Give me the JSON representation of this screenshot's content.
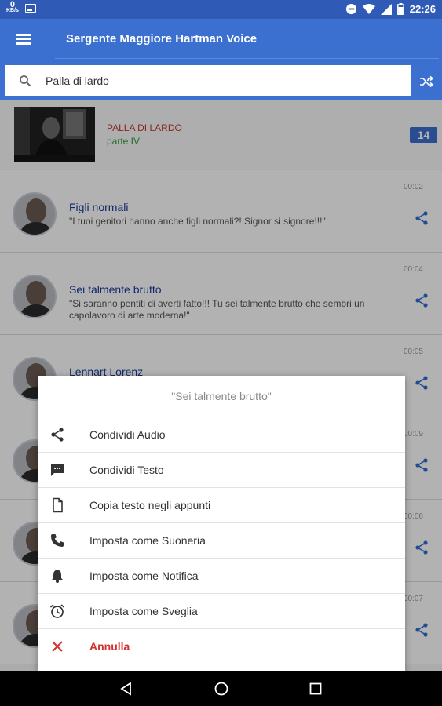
{
  "status_bar": {
    "speed_value": "0",
    "speed_unit": "KB/s",
    "time": "22:26"
  },
  "app_bar": {
    "title": "Sergente Maggiore Hartman Voice"
  },
  "search": {
    "query": "Palla di lardo"
  },
  "header_card": {
    "title": "PALLA DI LARDO",
    "subtitle": "parte IV",
    "count": "14",
    "colors": {
      "title": "#c0392b",
      "subtitle": "#2e9d3b",
      "badge": "#3b6fd0"
    }
  },
  "list": [
    {
      "time": "00:02",
      "title": "Figli normali",
      "text": "\"I tuoi genitori hanno anche figli normali?! Signor si signore!!!\""
    },
    {
      "time": "00:04",
      "title": "Sei talmente brutto",
      "text": "\"Si saranno pentiti di averti fatto!!! Tu sei talmente brutto che sembri un capolavoro di arte moderna!\""
    },
    {
      "time": "00:05",
      "title": "Lennart Lorenz",
      "text": ""
    },
    {
      "time": "00:09",
      "title": "",
      "text": ""
    },
    {
      "time": "00:06",
      "title": "",
      "text": ""
    },
    {
      "time": "00:07",
      "title": "",
      "text": ""
    }
  ],
  "dialog": {
    "title": "\"Sei talmente brutto\"",
    "items": [
      {
        "label": "Condividi Audio",
        "icon": "share-icon"
      },
      {
        "label": "Condividi Testo",
        "icon": "message-icon"
      },
      {
        "label": "Copia testo negli appunti",
        "icon": "file-copy-icon"
      },
      {
        "label": "Imposta come Suoneria",
        "icon": "phone-icon"
      },
      {
        "label": "Imposta come Notifica",
        "icon": "bell-icon"
      },
      {
        "label": "Imposta come Sveglia",
        "icon": "alarm-icon"
      }
    ],
    "cancel_label": "Annulla",
    "colors": {
      "cancel": "#d32f2f",
      "accent": "#3b6fd0"
    }
  }
}
